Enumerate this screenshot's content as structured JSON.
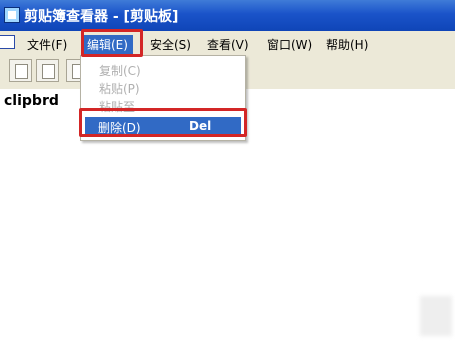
{
  "window": {
    "title": "剪贴簿查看器 - [剪贴板]"
  },
  "menubar": {
    "items": [
      "文件(F)",
      "编辑(E)",
      "安全(S)",
      "查看(V)",
      "窗口(W)",
      "帮助(H)"
    ]
  },
  "edit_menu": {
    "items": [
      {
        "label": "复制(C)",
        "enabled": false
      },
      {
        "label": "粘贴(P)",
        "enabled": false
      },
      {
        "label": "粘贴至",
        "enabled": false
      }
    ],
    "selected": {
      "label": "删除(D)",
      "accelerator": "Del"
    }
  },
  "content": {
    "text": "clipbrd"
  },
  "colors": {
    "highlight": "#d32626",
    "selection": "#316ac5",
    "titlebar": "#1a53c9"
  }
}
